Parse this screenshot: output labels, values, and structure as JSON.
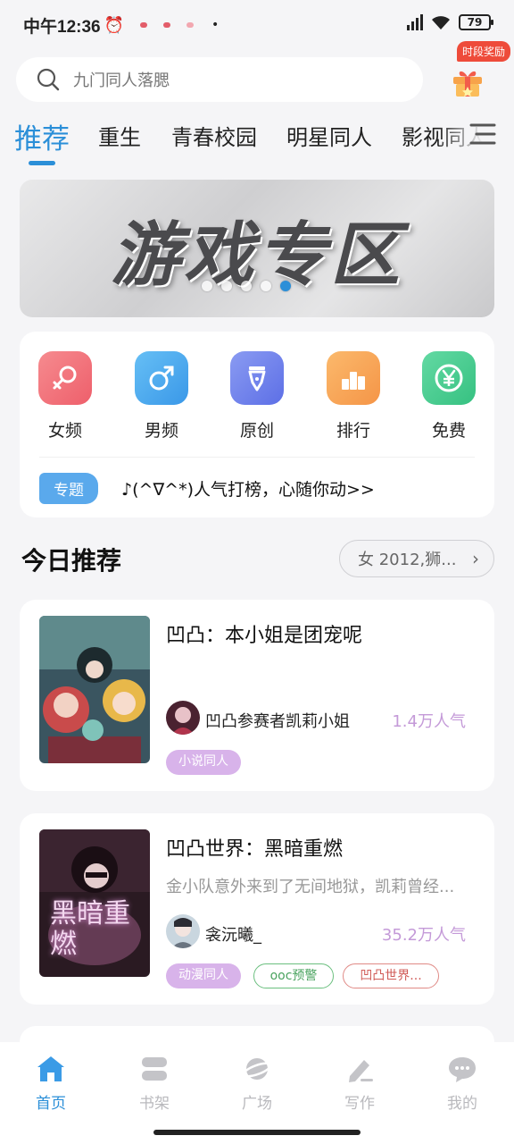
{
  "status_bar": {
    "time": "中午12:36",
    "battery": "79"
  },
  "search": {
    "placeholder": "九门同人落腮"
  },
  "reward": {
    "badge": "时段奖励"
  },
  "tabs": [
    {
      "label": "推荐",
      "active": true
    },
    {
      "label": "重生"
    },
    {
      "label": "青春校园"
    },
    {
      "label": "明星同人"
    },
    {
      "label": "影视同人"
    }
  ],
  "banner": {
    "text": "游戏专区",
    "dots": 5,
    "active_dot": 5
  },
  "categories": [
    {
      "label": "女频",
      "icon": "female-symbol-icon",
      "color": "#f2707a"
    },
    {
      "label": "男频",
      "icon": "male-symbol-icon",
      "color": "#4aa8ee"
    },
    {
      "label": "原创",
      "icon": "pen-nib-icon",
      "color": "#6f80ec"
    },
    {
      "label": "排行",
      "icon": "podium-icon",
      "color": "#f7a95a"
    },
    {
      "label": "免费",
      "icon": "yen-coin-icon",
      "color": "#45cc8f"
    }
  ],
  "topic": {
    "tag": "专题",
    "text": "♪(^∇^*)人气打榜，心随你动>>"
  },
  "today": {
    "title": "今日推荐",
    "filter": "女 2012,狮..."
  },
  "books": [
    {
      "title": "凹凸：本小姐是团宠呢",
      "description": "",
      "author": "凹凸参赛者凯莉小姐",
      "popularity": "1.4万人气",
      "tags": [
        {
          "label": "小说同人",
          "style": "filled"
        }
      ]
    },
    {
      "title": "凹凸世界：黑暗重燃",
      "description": "金小队意外来到了无间地狱，凯莉曾经...",
      "author": "衾沅曦_",
      "popularity": "35.2万人气",
      "tags": [
        {
          "label": "动漫同人",
          "style": "filled"
        },
        {
          "label": "ooc预警",
          "style": "green"
        },
        {
          "label": "凹凸世界...",
          "style": "red"
        }
      ],
      "cover_text": "黑暗重燃"
    }
  ],
  "bottom_nav": [
    {
      "label": "首页",
      "icon": "home-icon",
      "active": true
    },
    {
      "label": "书架",
      "icon": "bookshelf-icon"
    },
    {
      "label": "广场",
      "icon": "planet-icon"
    },
    {
      "label": "写作",
      "icon": "pencil-icon"
    },
    {
      "label": "我的",
      "icon": "chat-bubble-icon"
    }
  ],
  "colors": {
    "accent": "#2b8fd8",
    "popularity": "#c49ad8",
    "background": "#f5f5f7"
  }
}
